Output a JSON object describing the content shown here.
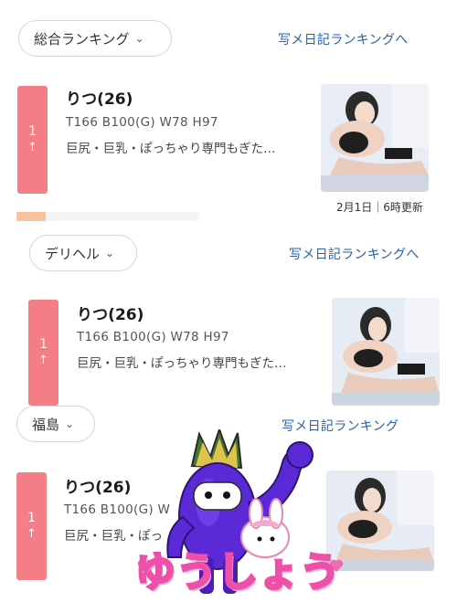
{
  "section1": {
    "filter_label": "総合ランキング",
    "diary_link": "写メ日記ランキングへ",
    "card": {
      "rank_number": "1",
      "rank_arrow": "↑",
      "name": "りつ(26)",
      "stats": "T166 B100(G) W78 H97",
      "description": "巨尻・巨乳・ぽっちゃり専門もぎた…",
      "updated": "2月1日｜6時更新"
    }
  },
  "section2": {
    "filter_label": "デリヘル",
    "diary_link": "写メ日記ランキングへ",
    "card": {
      "rank_number": "1",
      "rank_arrow": "↑",
      "name": "りつ(26)",
      "stats": "T166 B100(G) W78 H97",
      "description": "巨尻・巨乳・ぽっちゃり専門もぎた…"
    }
  },
  "section3": {
    "filter_label": "福島",
    "diary_link": "写メ日記ランキング",
    "card": {
      "rank_number": "1",
      "rank_arrow": "↑",
      "name": "りつ(26)",
      "stats": "T166 B100(G) W",
      "description": "巨尻・巨乳・ぽっ"
    }
  },
  "sticker": {
    "text": "ゆうしょう",
    "colors": {
      "outline": "#ee4fa9",
      "character": "#5b2ad6"
    }
  },
  "colors": {
    "rank_badge": "#f47e87",
    "link": "#2b5fa8"
  }
}
